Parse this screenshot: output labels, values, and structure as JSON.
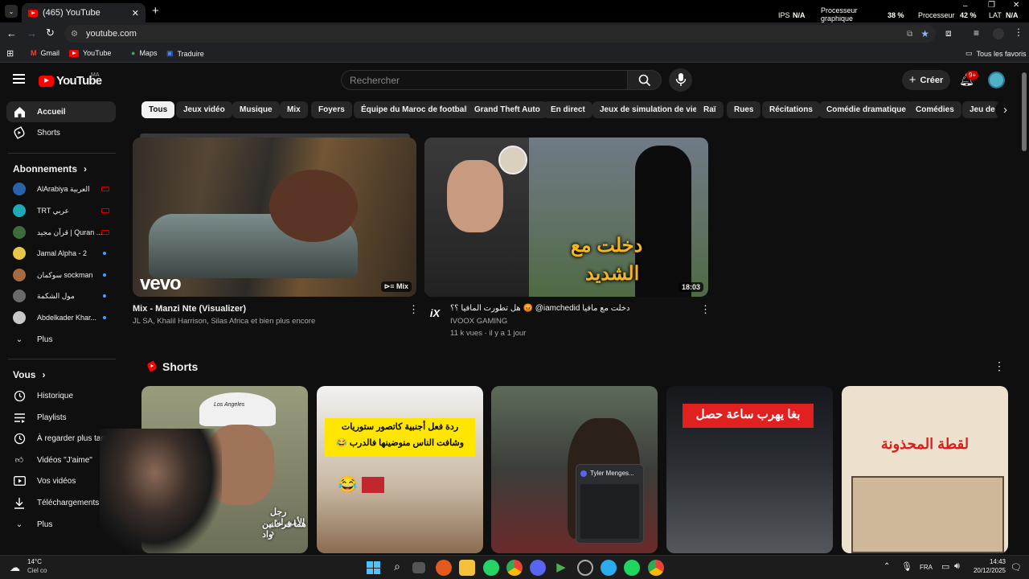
{
  "browser": {
    "tab_title": "(465) YouTube",
    "url": "youtube.com",
    "bookmarks": [
      "Gmail",
      "YouTube",
      "Maps",
      "Traduire"
    ],
    "all_bookmarks": "Tous les favoris",
    "stats": {
      "ips_label": "IPS",
      "ips_value": "N/A",
      "gpu_label_1": "Processeur",
      "gpu_label_2": "graphique",
      "gpu_value": "38 %",
      "cpu_label": "Processeur",
      "cpu_value": "42 %",
      "lat_label": "LAT",
      "lat_value": "N/A"
    }
  },
  "header": {
    "logo": "YouTube",
    "region": "MA",
    "search_placeholder": "Rechercher",
    "create_label": "Créer",
    "notif_count": "9+"
  },
  "sidebar": {
    "home": "Accueil",
    "shorts": "Shorts",
    "subscriptions_heading": "Abonnements",
    "subscriptions": [
      {
        "name": "AlArabiya العربية",
        "color": "#2a62a8",
        "badge": "live"
      },
      {
        "name": "TRT عربي",
        "color": "#1fa8b8",
        "badge": "live"
      },
      {
        "name": "قرآن مجيد | Quran ...",
        "color": "#3d6b3a",
        "badge": "live"
      },
      {
        "name": "Jamal Alpha - 2",
        "color": "#e8c64a",
        "badge": "dot"
      },
      {
        "name": "سوكمان sockman",
        "color": "#a56a40",
        "badge": "dot"
      },
      {
        "name": "مول الشكمة",
        "color": "#6a6a6a",
        "badge": "dot"
      },
      {
        "name": "Abdelkader Khar...",
        "color": "#c9c9c9",
        "badge": "dot"
      }
    ],
    "more_subs": "Plus",
    "you_heading": "Vous",
    "you_items": [
      "Historique",
      "Playlists",
      "À regarder plus tard",
      "Vidéos \"J'aime\"",
      "Vos vidéos",
      "Téléchargements",
      "Plus"
    ]
  },
  "chips": [
    "Tous",
    "Jeux vidéo",
    "Musique",
    "Mix",
    "Foyers",
    "Équipe du Maroc de football",
    "Grand Theft Auto",
    "En direct",
    "Jeux de simulation de vie",
    "Raï",
    "Rues",
    "Récitations",
    "Comédie dramatique",
    "Comédies",
    "Jeu de r"
  ],
  "videos": [
    {
      "title": "Mix - Manzi Nte (Visualizer)",
      "meta1": "JL SA, Khalil Harrison, Silas Africa et bien plus encore",
      "meta2": "",
      "overlay": "Mix",
      "brand": "vevo"
    },
    {
      "title": "دخلت مع مافيا iamchedid@ 😡 هل تطورت المافيا ؟؟",
      "meta1": "IVOOX GAMING",
      "meta2": "11 k vues · il y a 1 jour",
      "overlay": "18:03",
      "thumb_text_1": "دخلت مع",
      "thumb_text_2": "الشديد",
      "channel_mark": "iX"
    }
  ],
  "shorts": {
    "heading": "Shorts",
    "items": [
      {
        "caption_1": "رجل الأمن اش د",
        "caption_2": "هما فرحانين واد",
        "cap": "Los Angeles"
      },
      {
        "caption_1": "ردة فعل أجنبية كاتصور ستوريات",
        "caption_2": "وشافت الناس منوضينها فالدرب 😂",
        "emoji": "😂"
      },
      {
        "popup": "Tyler Menges..."
      },
      {
        "caption_1": "بغا يهرب ساعة حصل"
      },
      {
        "caption_1": "لقطة المحذونة"
      }
    ]
  },
  "taskbar": {
    "weather_temp": "14°C",
    "weather_desc": "Ciel co",
    "lang": "FRA",
    "time": "14:43",
    "date": "20/12/2025"
  }
}
